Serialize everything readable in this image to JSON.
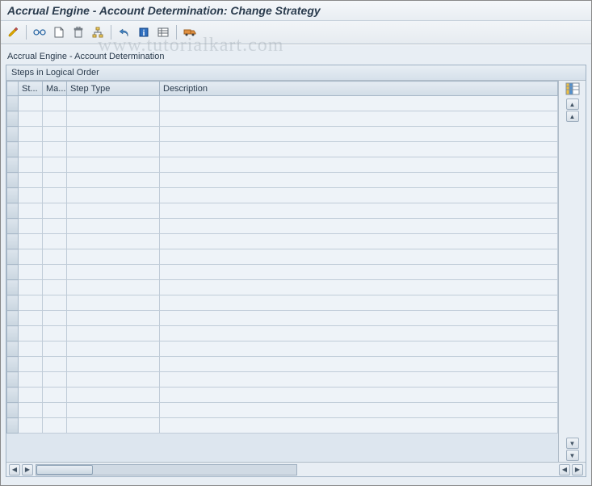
{
  "window": {
    "title": "Accrual Engine - Account Determination: Change Strategy"
  },
  "toolbar": {
    "icons": [
      {
        "name": "edit-icon",
        "glyph": "pencil"
      },
      {
        "sep": true
      },
      {
        "name": "display-icon",
        "glyph": "glasses"
      },
      {
        "name": "new-icon",
        "glyph": "page"
      },
      {
        "name": "delete-icon",
        "glyph": "trash"
      },
      {
        "name": "hierarchy-icon",
        "glyph": "tree"
      },
      {
        "sep": true
      },
      {
        "name": "undo-icon",
        "glyph": "undo"
      },
      {
        "name": "info-icon",
        "glyph": "info"
      },
      {
        "name": "list-icon",
        "glyph": "list"
      },
      {
        "sep": true
      },
      {
        "name": "transport-icon",
        "glyph": "truck"
      }
    ]
  },
  "subtitle": "Accrual Engine - Account Determination",
  "panel": {
    "title": "Steps in Logical Order",
    "columns": {
      "selector": "",
      "st": "St...",
      "ma": "Ma...",
      "step_type": "Step Type",
      "description": "Description"
    },
    "rows": [
      {},
      {},
      {},
      {},
      {},
      {},
      {},
      {},
      {},
      {},
      {},
      {},
      {},
      {},
      {},
      {},
      {},
      {},
      {},
      {},
      {},
      {}
    ]
  },
  "watermark": "www.tutorialkart.com"
}
